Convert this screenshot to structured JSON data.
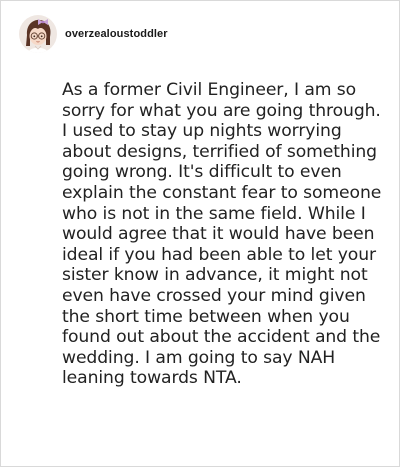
{
  "post": {
    "username": "overzealoustoddler",
    "avatar_icon": "cartoon-girl-with-glasses-avatar",
    "body": "As a former Civil Engineer, I am so sorry for what you are going through. I used to stay up nights worrying about designs, terrified of something going wrong. It's difficult to even explain the constant fear to someone who is not in the same field. While I would agree that it would have been ideal if you had been able to let your sister know in advance, it might not even have crossed your mind given the short time between when you found out about the accident and the wedding. I am going to say NAH leaning towards NTA."
  },
  "colors": {
    "text": "#222222",
    "username": "#1a1a1a",
    "border": "#d9d9d9",
    "background": "#ffffff"
  }
}
